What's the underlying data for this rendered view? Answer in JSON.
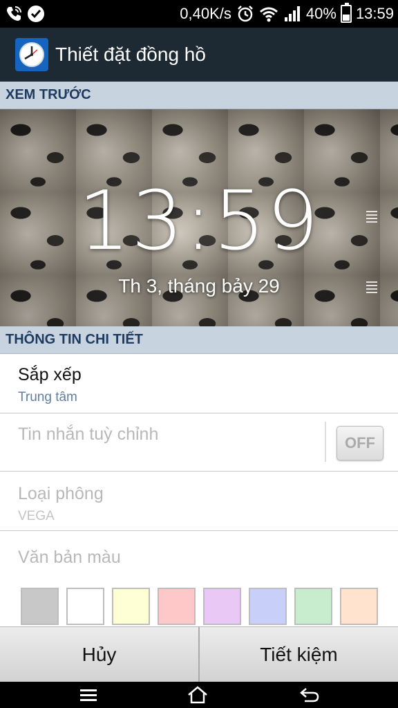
{
  "status_bar": {
    "net_speed": "0,40K/s",
    "battery_pct": "40%",
    "battery_level": 0.4,
    "time": "13:59",
    "icons": [
      "call-icon",
      "check-icon",
      "alarm-icon",
      "wifi-icon",
      "signal-icon",
      "battery-icon"
    ]
  },
  "action_bar": {
    "title": "Thiết đặt đồng hồ",
    "icon": "clock-app-icon"
  },
  "preview": {
    "header": "XEM TRƯỚC",
    "time": "13:59",
    "date": "Th 3, tháng bảy 29"
  },
  "details": {
    "header": "THÔNG TIN CHI TIẾT",
    "arrange": {
      "title": "Sắp xếp",
      "value": "Trung tâm"
    },
    "custom_message": {
      "title": "Tin nhắn tuỳ chỉnh",
      "toggle": "OFF"
    },
    "font_type": {
      "title": "Loại phông",
      "value": "VEGA"
    },
    "text_color": {
      "title": "Văn bản màu",
      "swatches": [
        "#c8c8c8",
        "#ffffff",
        "#ffffd6",
        "#ffc8c8",
        "#e9c8f5",
        "#c8cff8",
        "#c8ecce",
        "#ffe3cf"
      ]
    }
  },
  "buttons": {
    "cancel": "Hủy",
    "save": "Tiết kiệm"
  },
  "nav": [
    "menu-icon",
    "home-icon",
    "back-icon"
  ],
  "colors": {
    "status_bar": "#000000",
    "action_bar": "#1e2a33",
    "section_header_bg": "#c7d4e0",
    "section_header_text": "#1e3a5f",
    "subtitle": "#5f7fa0"
  }
}
